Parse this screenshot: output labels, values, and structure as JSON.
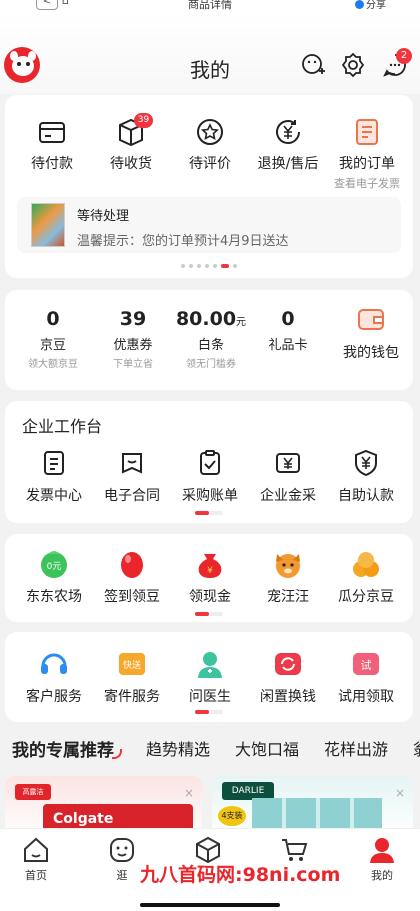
{
  "topbar": {
    "title": "商品详情",
    "back_label": "<",
    "share_label": "分享"
  },
  "header": {
    "title": "我的",
    "message_badge": "2"
  },
  "orders": {
    "items": [
      {
        "label": "待付款",
        "icon": "wallet-card-icon"
      },
      {
        "label": "待收货",
        "icon": "package-icon",
        "badge": "39"
      },
      {
        "label": "待评价",
        "icon": "star-review-icon"
      },
      {
        "label": "退换/售后",
        "icon": "yen-return-icon"
      },
      {
        "label": "我的订单",
        "sub": "查看电子发票",
        "icon": "order-list-icon"
      }
    ],
    "pending": {
      "title": "等待处理",
      "tip": "温馨提示：您的订单预计4月9日送达"
    }
  },
  "assets": {
    "items": [
      {
        "value": "0",
        "label": "京豆",
        "sub": "领大额京豆"
      },
      {
        "value": "39",
        "label": "优惠券",
        "sub": "下单立省"
      },
      {
        "value": "80.00",
        "unit": "元",
        "label": "白条",
        "sub": "领无门槛券"
      },
      {
        "value": "0",
        "label": "礼品卡",
        "sub": ""
      }
    ],
    "wallet_label": "我的钱包"
  },
  "enterprise": {
    "title": "企业工作台",
    "items": [
      {
        "label": "发票中心"
      },
      {
        "label": "电子合同"
      },
      {
        "label": "采购账单"
      },
      {
        "label": "企业金采"
      },
      {
        "label": "自助认款"
      }
    ]
  },
  "services1": {
    "items": [
      {
        "label": "东东农场",
        "tag": "0元"
      },
      {
        "label": "签到领豆"
      },
      {
        "label": "领现金",
        "tag": "¥"
      },
      {
        "label": "宠汪汪"
      },
      {
        "label": "瓜分京豆"
      }
    ]
  },
  "services2": {
    "items": [
      {
        "label": "客户服务"
      },
      {
        "label": "寄件服务",
        "tag": "快送"
      },
      {
        "label": "问医生"
      },
      {
        "label": "闲置换钱"
      },
      {
        "label": "试用领取",
        "tag": "试"
      }
    ]
  },
  "tabs": [
    "我的专属推荐",
    "趋势精选",
    "大饱口福",
    "花样出游",
    "翁"
  ],
  "recommend": {
    "brand1": "Colgate",
    "brand1_top": "高露洁",
    "brand2": "DARLIE",
    "brand2_sub": "4支装",
    "close": "×"
  },
  "nav": [
    {
      "label": "首页"
    },
    {
      "label": "逛"
    },
    {
      "label": ""
    },
    {
      "label": ""
    },
    {
      "label": "我的"
    }
  ],
  "watermark": "九八首码网:98ni.com",
  "colors": {
    "accent": "#f0353f",
    "text": "#222222",
    "bg": "#f2f2f2"
  }
}
